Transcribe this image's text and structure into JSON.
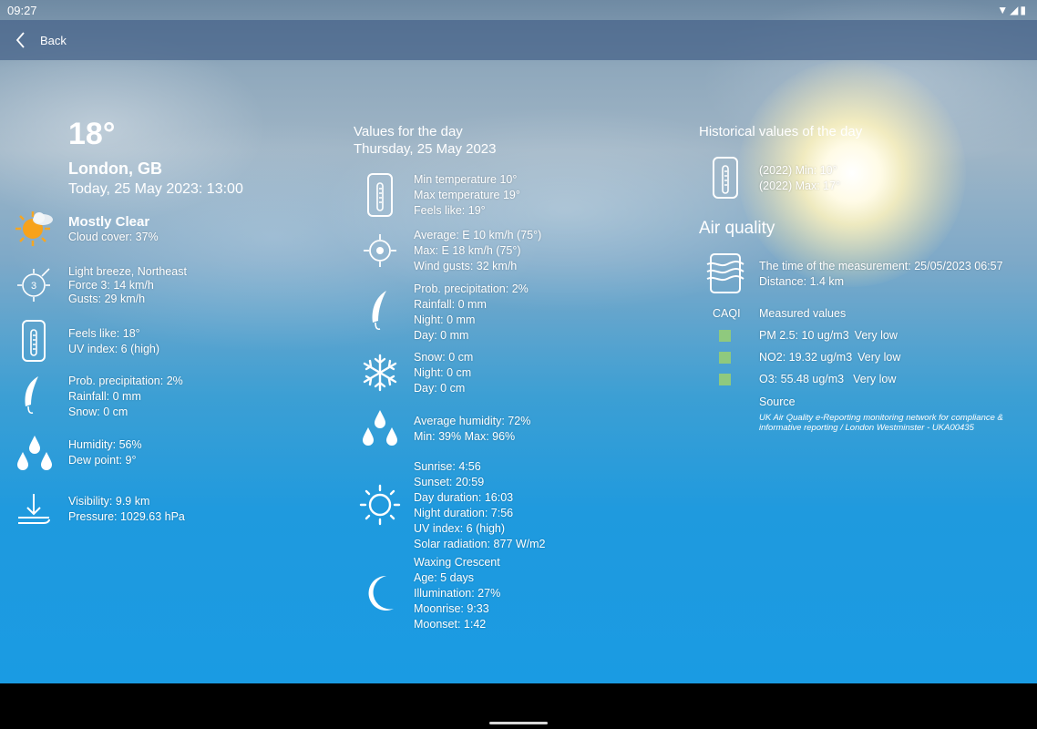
{
  "status": {
    "time": "09:27",
    "icons": "▼◢▮"
  },
  "appbar": {
    "back_label": "Back"
  },
  "current": {
    "temperature": "18°",
    "location": "London, GB",
    "datetime": "Today, 25 May 2023: 13:00",
    "condition": "Mostly Clear",
    "cloud_cover": "Cloud cover: 37%",
    "wind": [
      "Light breeze, Northeast",
      "Force 3: 14 km/h",
      "Gusts: 29 km/h"
    ],
    "wind_force_badge": "3",
    "feels": [
      "Feels like: 18°",
      "UV index: 6 (high)"
    ],
    "precip": [
      "Prob. precipitation: 2%",
      "Rainfall: 0 mm",
      "Snow: 0 cm"
    ],
    "humidity": [
      "Humidity: 56%",
      "Dew point: 9°"
    ],
    "visibility": [
      "Visibility: 9.9 km",
      "Pressure: 1029.63 hPa"
    ]
  },
  "day": {
    "heading": "Values for the day",
    "date": "Thursday, 25 May 2023",
    "temps": [
      "Min temperature 10°",
      "Max temperature 19°",
      "Feels like: 19°"
    ],
    "wind": [
      "Average: E 10 km/h (75°)",
      "Max: E 18 km/h (75°)",
      "Wind gusts: 32 km/h"
    ],
    "precip": [
      "Prob. precipitation: 2%",
      "Rainfall: 0 mm",
      "Night: 0 mm",
      "Day: 0 mm"
    ],
    "snow": [
      "Snow: 0 cm",
      "Night: 0 cm",
      "Day: 0 cm"
    ],
    "humidity": [
      "Average humidity: 72%",
      "Min: 39% Max: 96%"
    ],
    "sun": [
      "Sunrise: 4:56",
      "Sunset: 20:59",
      "Day duration: 16:03",
      "Night duration: 7:56",
      "UV index: 6 (high)",
      "Solar radiation: 877 W/m2"
    ],
    "moon": [
      "Waxing Crescent",
      "Age: 5 days",
      "Illumination: 27%",
      "Moonrise: 9:33",
      "Moonset: 1:42"
    ]
  },
  "history": {
    "heading": "Historical values of the day",
    "values": [
      "(2022) Min: 10°",
      "(2022) Max: 17°"
    ]
  },
  "air": {
    "heading": "Air quality",
    "measurement": [
      "The time of the measurement: 25/05/2023 06:57",
      "Distance: 1.4 km"
    ],
    "caqi_label": "CAQI",
    "measured_label": "Measured values",
    "rows": [
      {
        "value": "PM 2.5: 10 ug/m3",
        "level": "Very low"
      },
      {
        "value": "NO2: 19.32 ug/m3",
        "level": "Very low"
      },
      {
        "value": "O3: 55.48 ug/m3",
        "level": "Very low"
      }
    ],
    "source_label": "Source",
    "source_text": [
      "UK Air Quality e-Reporting monitoring network for compliance &",
      "informative reporting / London Westminster - UKA00435"
    ],
    "level_color": "#8fc97e"
  }
}
